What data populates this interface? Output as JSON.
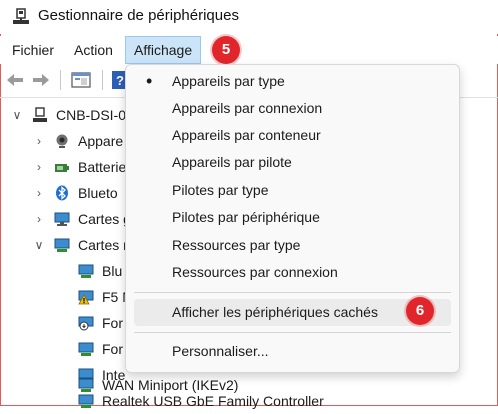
{
  "window": {
    "title": "Gestionnaire de périphériques"
  },
  "menubar": {
    "items": [
      "Fichier",
      "Action",
      "Affichage"
    ]
  },
  "badges": {
    "menu": "5",
    "hidden": "6"
  },
  "colors": {
    "badge": "#e0262b",
    "frame": "#e35a5a",
    "menu_active": "#cce4f7"
  },
  "toolbar": {
    "icons": [
      "back-arrow-icon",
      "forward-arrow-icon",
      "properties-icon",
      "help-icon"
    ]
  },
  "tree": {
    "root": "CNB-DSI-0",
    "categories": [
      "Appare",
      "Batterie",
      "Blueto",
      "Cartes g",
      "Cartes r"
    ],
    "adapters": [
      "Blu",
      "F5 N",
      "For",
      "For",
      "Inte",
      "Realtek USB GbE Family Controller",
      "WAN Miniport (IKEv2)"
    ]
  },
  "dropdown": {
    "items": [
      {
        "label": "Appareils par type",
        "checked": true
      },
      {
        "label": "Appareils par connexion"
      },
      {
        "label": "Appareils par conteneur"
      },
      {
        "label": "Appareils par pilote"
      },
      {
        "label": "Pilotes par type"
      },
      {
        "label": "Pilotes par périphérique"
      },
      {
        "label": "Ressources par type"
      },
      {
        "label": "Ressources par connexion"
      },
      {
        "label": "Afficher les périphériques cachés"
      },
      {
        "label": "Personnaliser..."
      }
    ]
  }
}
